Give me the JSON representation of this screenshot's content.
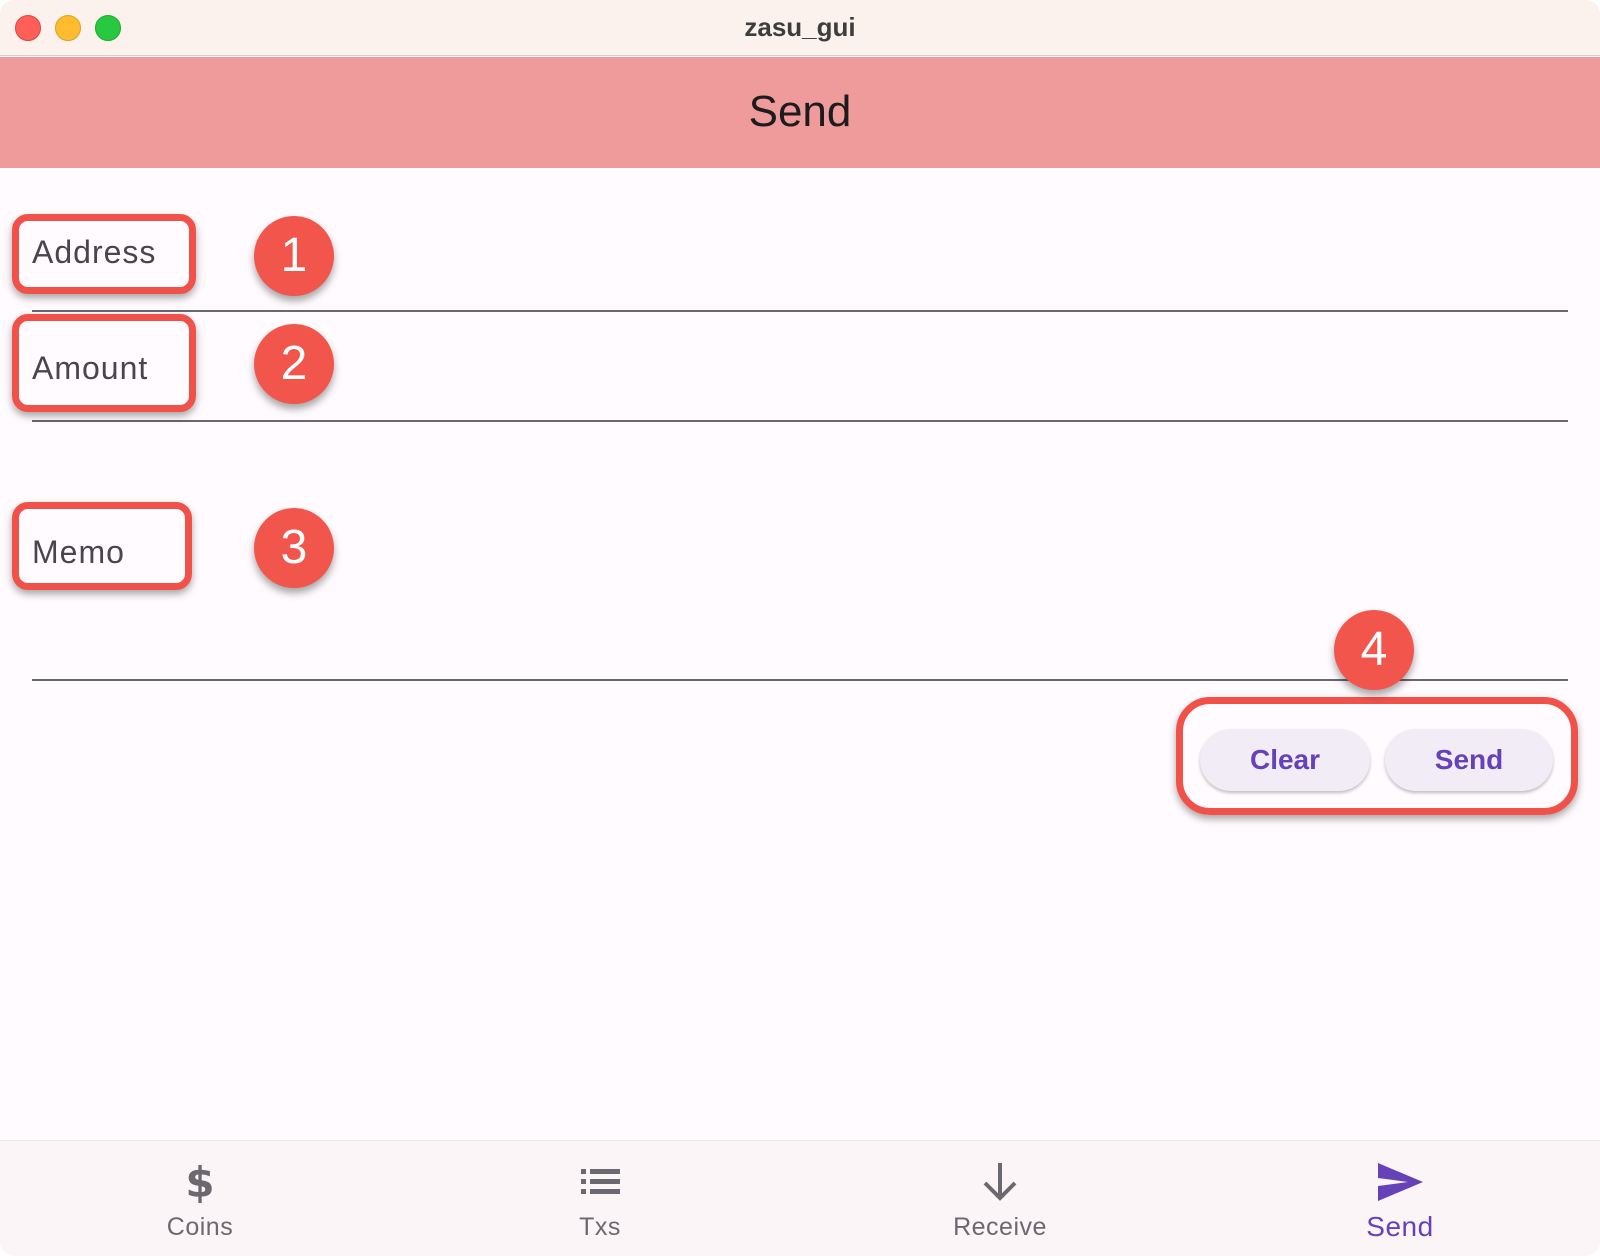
{
  "window": {
    "title": "zasu_gui"
  },
  "appbar": {
    "title": "Send"
  },
  "form": {
    "address_label": "Address",
    "amount_label": "Amount",
    "memo_label": "Memo"
  },
  "annotations": {
    "badge1": "1",
    "badge2": "2",
    "badge3": "3",
    "badge4": "4"
  },
  "actions": {
    "clear_label": "Clear",
    "send_label": "Send"
  },
  "bottom_nav": {
    "items": [
      {
        "label": "Coins",
        "icon": "dollar-icon",
        "active": false
      },
      {
        "label": "Txs",
        "icon": "list-icon",
        "active": false
      },
      {
        "label": "Receive",
        "icon": "arrow-down-icon",
        "active": false
      },
      {
        "label": "Send",
        "icon": "send-icon",
        "active": true
      }
    ]
  },
  "colors": {
    "appbar": "#ef9a9b",
    "accent": "#6641b8",
    "annotation": "#f0524a"
  }
}
